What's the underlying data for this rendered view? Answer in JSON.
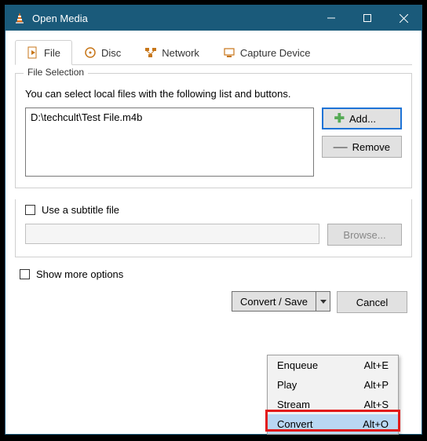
{
  "title": "Open Media",
  "tabs": [
    {
      "label": "File"
    },
    {
      "label": "Disc"
    },
    {
      "label": "Network"
    },
    {
      "label": "Capture Device"
    }
  ],
  "fileSelection": {
    "groupTitle": "File Selection",
    "hint": "You can select local files with the following list and buttons.",
    "files": [
      "D:\\techcult\\Test File.m4b"
    ],
    "addLabel": "Add...",
    "removeLabel": "Remove"
  },
  "subtitle": {
    "check": "Use a subtitle file",
    "browse": "Browse..."
  },
  "showMore": "Show more options",
  "bottom": {
    "convertSave": "Convert / Save",
    "cancel": "Cancel"
  },
  "menu": [
    {
      "label": "Enqueue",
      "accel": "Alt+E"
    },
    {
      "label": "Play",
      "accel": "Alt+P"
    },
    {
      "label": "Stream",
      "accel": "Alt+S"
    },
    {
      "label": "Convert",
      "accel": "Alt+O"
    }
  ]
}
